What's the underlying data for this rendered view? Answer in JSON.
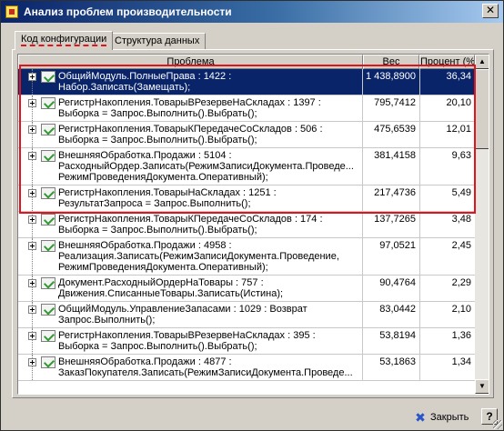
{
  "window": {
    "title": "Анализ проблем производительности",
    "close_glyph": "✕"
  },
  "tabs": [
    {
      "label": "Код конфигурации",
      "active": true
    },
    {
      "label": "Структура данных",
      "active": false
    }
  ],
  "grid": {
    "columns": {
      "problem": "Проблема",
      "weight": "Вес",
      "percent": "Процент (%)"
    },
    "rows": [
      {
        "problem": "ОбщийМодуль.ПолныеПрава : 1422 :\nНабор.Записать(Замещать);",
        "weight": "1 438,8900",
        "percent": "36,34",
        "selected": true
      },
      {
        "problem": "РегистрНакопления.ТоварыВРезервеНаСкладах : 1397 :\nВыборка = Запрос.Выполнить().Выбрать();",
        "weight": "795,7412",
        "percent": "20,10"
      },
      {
        "problem": "РегистрНакопления.ТоварыКПередачеСоСкладов : 506 :\nВыборка = Запрос.Выполнить().Выбрать();",
        "weight": "475,6539",
        "percent": "12,01"
      },
      {
        "problem": "ВнешняяОбработка.Продажи : 5104 :\nРасходныйОрдер.Записать(РежимЗаписиДокумента.Проведе...\n РежимПроведенияДокумента.Оперативный);",
        "weight": "381,4158",
        "percent": "9,63"
      },
      {
        "problem": "РегистрНакопления.ТоварыНаСкладах : 1251 :\nРезультатЗапроса = Запрос.Выполнить();",
        "weight": "217,4736",
        "percent": "5,49"
      },
      {
        "problem": "РегистрНакопления.ТоварыКПередачеСоСкладов : 174 :\nВыборка = Запрос.Выполнить().Выбрать();",
        "weight": "137,7265",
        "percent": "3,48"
      },
      {
        "problem": "ВнешняяОбработка.Продажи : 4958 :\nРеализация.Записать(РежимЗаписиДокумента.Проведение,\nРежимПроведенияДокумента.Оперативный);",
        "weight": "97,0521",
        "percent": "2,45"
      },
      {
        "problem": "Документ.РасходныйОрдерНаТовары : 757 :\nДвижения.СписанныеТовары.Записать(Истина);",
        "weight": "90,4764",
        "percent": "2,29"
      },
      {
        "problem": "ОбщийМодуль.УправлениеЗапасами : 1029 : Возврат\nЗапрос.Выполнить();",
        "weight": "83,0442",
        "percent": "2,10"
      },
      {
        "problem": "РегистрНакопления.ТоварыВРезервеНаСкладах : 395 :\nВыборка = Запрос.Выполнить().Выбрать();",
        "weight": "53,8194",
        "percent": "1,36"
      },
      {
        "problem": "ВнешняяОбработка.Продажи : 4877 :\nЗаказПокупателя.Записать(РежимЗаписиДокумента.Проведе...",
        "weight": "53,1863",
        "percent": "1,34"
      }
    ]
  },
  "scrollbar": {
    "up_glyph": "▲",
    "down_glyph": "▼"
  },
  "footer": {
    "close_label": "Закрыть",
    "close_icon": "close-x-icon",
    "help_label": "?"
  }
}
